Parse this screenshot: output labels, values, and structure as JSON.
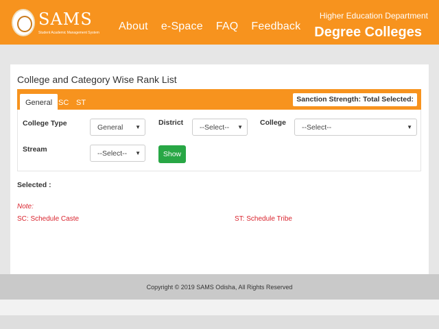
{
  "header": {
    "logo_text": "SAMS",
    "logo_subtitle": "Student Academic Management System",
    "nav": [
      "About",
      "e-Space",
      "FAQ",
      "Feedback"
    ],
    "department": "Higher Education Department",
    "portal": "Degree Colleges",
    "colors": {
      "brand": "#f7931e"
    }
  },
  "panel": {
    "title": "College and Category Wise Rank List",
    "tabs": [
      "General",
      "SC",
      "ST"
    ],
    "active_tab": "General",
    "sanction": "Sanction Strength: Total Selected:"
  },
  "form": {
    "college_type_label": "College Type",
    "college_type_value": "General",
    "district_label": "District",
    "district_value": "--Select--",
    "college_label": "College",
    "college_value": "--Select--",
    "stream_label": "Stream",
    "stream_value": "--Select--",
    "show_label": "Show"
  },
  "info": {
    "selected": "Selected :",
    "note": "Note:",
    "sc": "SC:  Schedule Caste",
    "st": "ST:  Schedule Tribe"
  },
  "footer": {
    "copyright": "Copyright © 2019 SAMS Odisha, All Rights Reserved"
  }
}
